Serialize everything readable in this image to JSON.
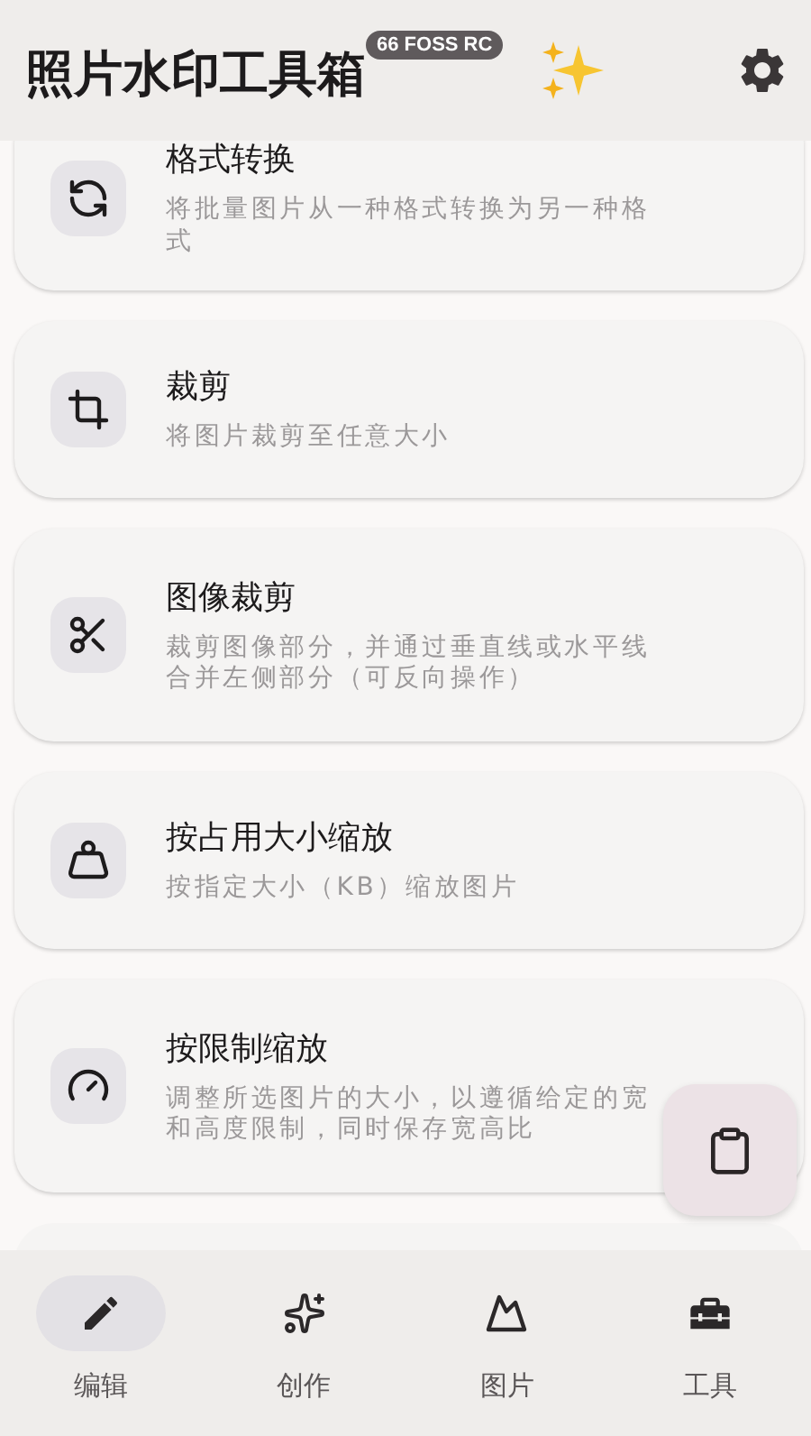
{
  "app_bar": {
    "title": "照片水印工具箱",
    "badge": "66 FOSS RC"
  },
  "tools": [
    {
      "title": "格式转换",
      "description": "将批量图片从一种格式转换为另一种格式"
    },
    {
      "title": "裁剪",
      "description": "将图片裁剪至任意大小"
    },
    {
      "title": "图像裁剪",
      "description": "裁剪图像部分，并通过垂直线或水平线合并左侧部分（可反向操作）"
    },
    {
      "title": "按占用大小缩放",
      "description": "按指定大小（KB）缩放图片"
    },
    {
      "title": "按限制缩放",
      "description": "调整所选图片的大小，以遵循给定的宽和高度限制，同时保存宽高比"
    }
  ],
  "bottom_nav": [
    {
      "label": "编辑",
      "selected": true
    },
    {
      "label": "创作",
      "selected": false
    },
    {
      "label": "图片",
      "selected": false
    },
    {
      "label": "工具",
      "selected": false
    }
  ]
}
